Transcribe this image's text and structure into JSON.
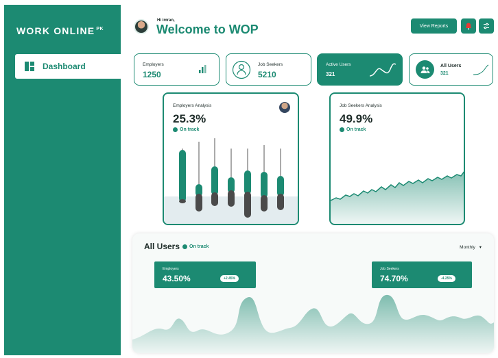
{
  "brand": {
    "name": "WORK ONLINE",
    "suffix": "PK"
  },
  "sidebar": {
    "items": [
      {
        "label": "Dashboard",
        "icon": "dashboard-grid-icon"
      }
    ]
  },
  "header": {
    "greeting": "Hi imran,",
    "title": "Welcome to WOP",
    "report_button": "View Reports",
    "notification_icon": "bell-icon",
    "settings_icon": "sliders-icon"
  },
  "stats": [
    {
      "title": "Employers",
      "value": "1250"
    },
    {
      "title": "Job Seekers",
      "value": "5210"
    },
    {
      "title": "Active Users",
      "value": "321"
    },
    {
      "title": "All Users",
      "value": "321"
    }
  ],
  "employers_analysis": {
    "title": "Employers Analysis",
    "value": "25.3%",
    "status": "On track"
  },
  "job_seekers_analysis": {
    "title": "Job Seekers Analysis",
    "value": "49.9%",
    "status": "On track"
  },
  "all_users": {
    "title": "All Users",
    "status": "On track",
    "period": "Monthly",
    "employers": {
      "label": "Employers",
      "value": "43.50%",
      "change": "+2.45%"
    },
    "job_seekers": {
      "label": "Job Seekers",
      "value": "74.70%",
      "change": "-4.25%"
    }
  },
  "colors": {
    "accent": "#1c8a72",
    "dark_bar": "#4a4a4a"
  }
}
